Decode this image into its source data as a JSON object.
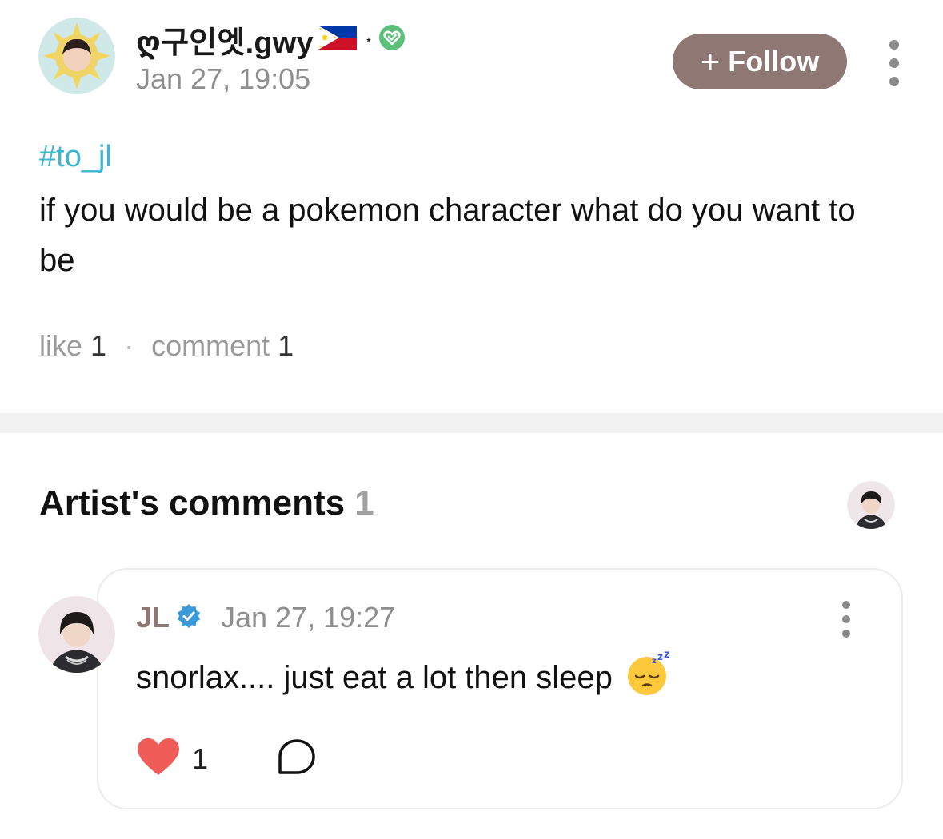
{
  "post": {
    "author": {
      "name": "ღ구인엣.gwy",
      "flag_icon": "philippines-flag-icon",
      "verified_icon": "green-heart-check-icon",
      "separator": "⋆"
    },
    "date": "Jan 27, 19:05",
    "follow_button": {
      "label": "Follow",
      "icon": "plus-icon"
    },
    "more_icon": "vertical-ellipsis-icon",
    "hashtag": "#to_jl",
    "body": "if you would be a pokemon character what do you want to be",
    "stats": {
      "like_label": "like",
      "like_count": "1",
      "separator": "·",
      "comment_label": "comment",
      "comment_count": "1"
    }
  },
  "artist_comments": {
    "title": "Artist's comments",
    "count": "1",
    "comments": [
      {
        "author": "JL",
        "verified_icon": "blue-verified-badge-icon",
        "date": "Jan 27, 19:27",
        "text": "snorlax.... just eat a lot then sleep",
        "emoji": "sleeping-face-emoji",
        "like_count": "1",
        "like_icon": "heart-icon",
        "reply_icon": "comment-bubble-icon",
        "more_icon": "vertical-ellipsis-icon"
      }
    ]
  },
  "colors": {
    "follow_bg": "#8f7874",
    "hashtag": "#3fb6cf",
    "verified_green": "#5cc07a",
    "verified_blue": "#3a9ad9",
    "heart": "#ef5b57",
    "divider": "#f2f2f2"
  }
}
